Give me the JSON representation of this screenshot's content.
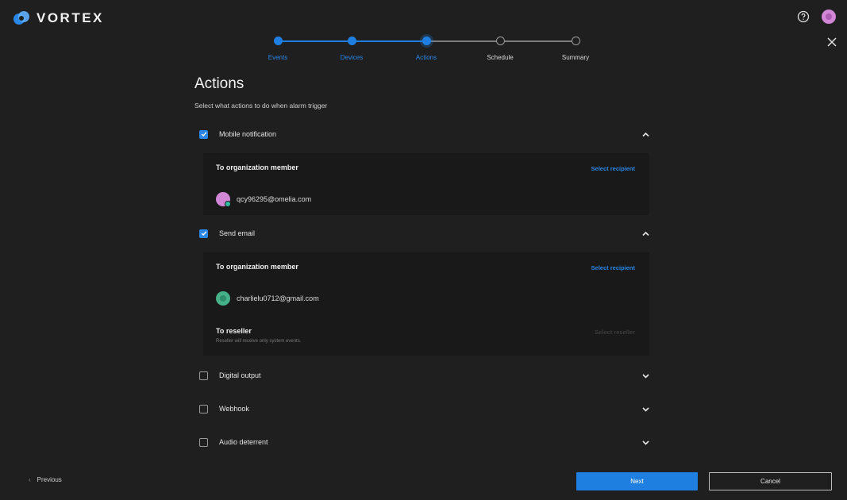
{
  "app": {
    "brand": "VORTEX"
  },
  "header": {
    "help_icon": "help-circle-icon",
    "close_icon": "close-icon"
  },
  "colors": {
    "accent": "#1e7fe0",
    "background": "#1f1f20",
    "panel": "#19191a",
    "avatar_pink": "#d287d6",
    "avatar_green": "#46b189"
  },
  "stepper": {
    "steps": [
      {
        "label": "Events",
        "state": "done"
      },
      {
        "label": "Devices",
        "state": "done"
      },
      {
        "label": "Actions",
        "state": "current"
      },
      {
        "label": "Schedule",
        "state": "todo"
      },
      {
        "label": "Summary",
        "state": "todo"
      }
    ]
  },
  "page": {
    "title": "Actions",
    "subtitle": "Select what actions to do when alarm trigger"
  },
  "actions": {
    "mobile": {
      "label": "Mobile notification",
      "checked": true,
      "expanded": true,
      "section_title": "To organization member",
      "select_link": "Select recipient",
      "recipients": [
        "qcy96295@omelia.com"
      ]
    },
    "email": {
      "label": "Send email",
      "checked": true,
      "expanded": true,
      "section_title": "To organization member",
      "select_link": "Select recipient",
      "recipients": [
        "charlielu0712@gmail.com"
      ],
      "reseller_title": "To reseller",
      "reseller_note": "Reseller will receive only system events.",
      "reseller_link": "Select reseller"
    },
    "digital_output": {
      "label": "Digital output",
      "checked": false,
      "expanded": false
    },
    "webhook": {
      "label": "Webhook",
      "checked": false,
      "expanded": false
    },
    "audio": {
      "label": "Audio deterrent",
      "checked": false,
      "expanded": false
    }
  },
  "footer": {
    "previous_label": "Previous",
    "next_label": "Next",
    "cancel_label": "Cancel"
  }
}
